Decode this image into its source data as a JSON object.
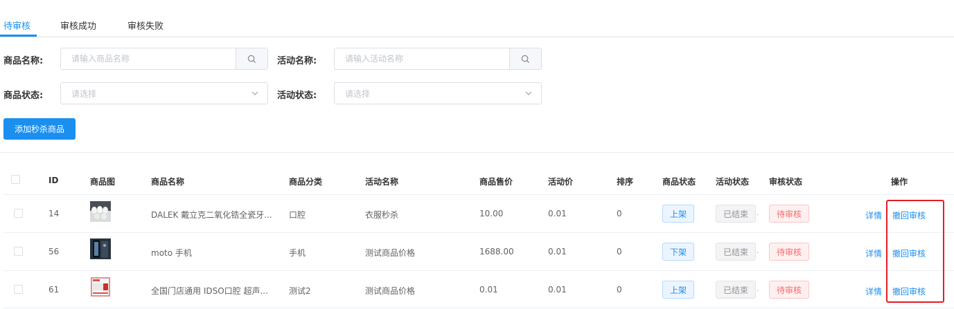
{
  "tabs": [
    {
      "label": "待审核",
      "active": true
    },
    {
      "label": "审核成功",
      "active": false
    },
    {
      "label": "审核失败",
      "active": false
    }
  ],
  "filters": {
    "product_name_label": "商品名称:",
    "product_name_placeholder": "请输入商品名称",
    "activity_name_label": "活动名称:",
    "activity_name_placeholder": "请输入活动名称",
    "product_status_label": "商品状态:",
    "product_status_placeholder": "请选择",
    "activity_status_label": "活动状态:",
    "activity_status_placeholder": "请选择"
  },
  "add_button_label": "添加秒杀商品",
  "table": {
    "headers": [
      "ID",
      "商品图",
      "商品名称",
      "商品分类",
      "活动名称",
      "商品售价",
      "活动价",
      "排序",
      "商品状态",
      "活动状态",
      "审核状态",
      "操作"
    ],
    "rows": [
      {
        "id": "14",
        "name": "DALEK 戴立克二氧化锆全瓷牙...",
        "category": "口腔",
        "activity": "衣服秒杀",
        "price": "10.00",
        "activity_price": "0.01",
        "sort": "0",
        "product_status": "上架",
        "activity_status": "已结束",
        "audit_status": "待审核",
        "detail": "详情",
        "revoke": "撤回审核",
        "thumb": "teeth"
      },
      {
        "id": "56",
        "name": "moto 手机",
        "category": "手机",
        "activity": "测试商品价格",
        "price": "1688.00",
        "activity_price": "0.01",
        "sort": "0",
        "product_status": "下架",
        "activity_status": "已结束",
        "audit_status": "待审核",
        "detail": "详情",
        "revoke": "撤回审核",
        "thumb": "phone"
      },
      {
        "id": "61",
        "name": "全国门店通用 IDSO口腔 超声...",
        "category": "测试2",
        "activity": "测试商品价格",
        "price": "0.01",
        "activity_price": "0.01",
        "sort": "0",
        "product_status": "上架",
        "activity_status": "已结束",
        "audit_status": "待审核",
        "detail": "详情",
        "revoke": "撤回审核",
        "thumb": "voucher"
      }
    ]
  },
  "colors": {
    "primary": "#1a8ff0",
    "danger": "#f56c6c",
    "highlight_box": "#e51c23"
  }
}
